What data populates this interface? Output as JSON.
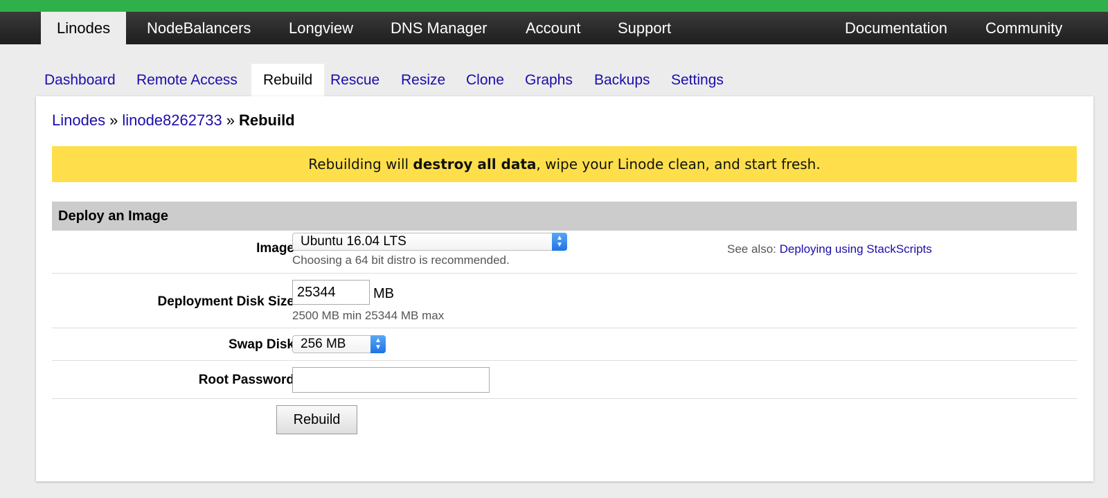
{
  "top_nav": {
    "items": [
      "Linodes",
      "NodeBalancers",
      "Longview",
      "DNS Manager",
      "Account",
      "Support"
    ],
    "right_items": [
      "Documentation",
      "Community"
    ],
    "active": "Linodes"
  },
  "sub_tabs": {
    "items": [
      "Dashboard",
      "Remote Access",
      "Rebuild",
      "Rescue",
      "Resize",
      "Clone",
      "Graphs",
      "Backups",
      "Settings"
    ],
    "active": "Rebuild"
  },
  "breadcrumb": {
    "root": "Linodes",
    "separator": "»",
    "linode": "linode8262733",
    "current": "Rebuild"
  },
  "warning": {
    "before": "Rebuilding will ",
    "bold": "destroy all data",
    "after": ", wipe your Linode clean, and start fresh."
  },
  "form": {
    "section_title": "Deploy an Image",
    "image": {
      "label": "Image",
      "selected": "Ubuntu 16.04 LTS",
      "hint": "Choosing a 64 bit distro is recommended.",
      "see_also_label": "See also: ",
      "see_also_link": "Deploying using StackScripts"
    },
    "disk_size": {
      "label": "Deployment Disk Size",
      "value": "25344",
      "unit": "MB",
      "hint": "2500 MB min 25344 MB max"
    },
    "swap": {
      "label": "Swap Disk",
      "selected": "256 MB"
    },
    "root_password": {
      "label": "Root Password",
      "value": ""
    },
    "submit_label": "Rebuild"
  },
  "colors": {
    "brand_green": "#30b04b",
    "warning_yellow": "#fedf4b",
    "link_blue": "#1a0dab"
  }
}
